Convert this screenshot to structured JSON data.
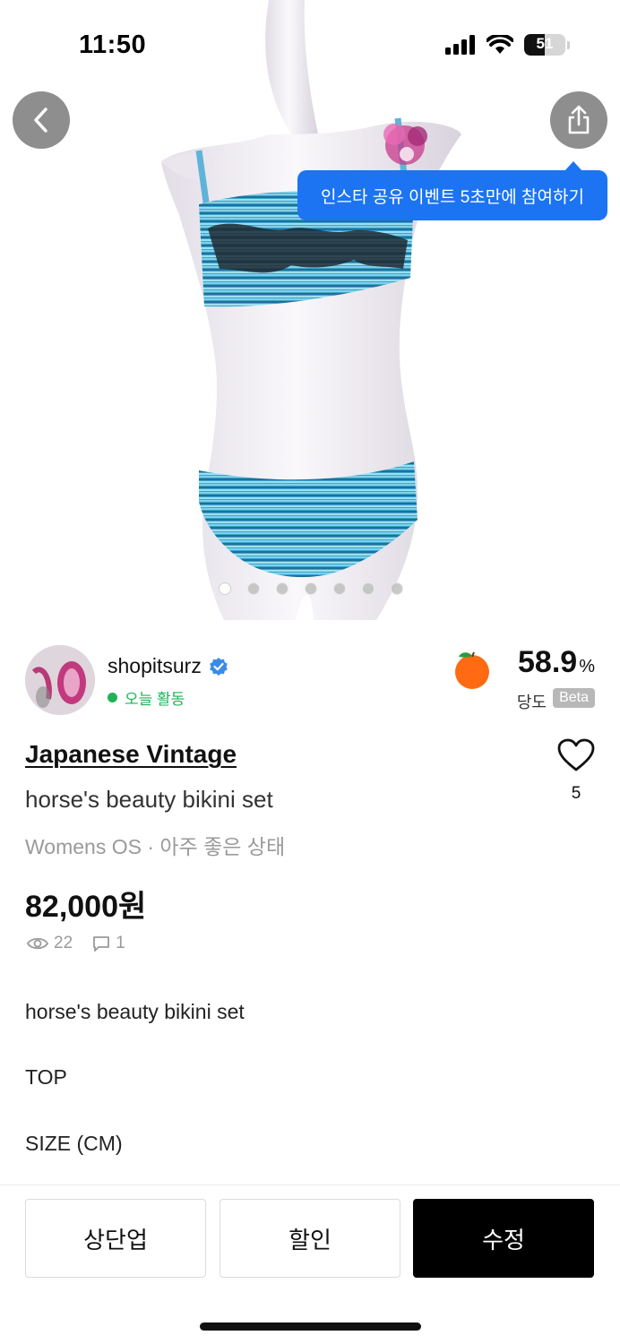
{
  "status_bar": {
    "time": "11:50",
    "battery_level": "51",
    "battery_fraction": 0.51
  },
  "hero": {
    "tooltip_text": "인스타 공유 이벤트 5초만에 참여하기",
    "image_count": 7,
    "active_image_index": 0
  },
  "seller": {
    "name": "shopitsurz",
    "activity": "오늘 활동",
    "sugar_value": "58.9",
    "sugar_unit": "%",
    "sugar_label": "당도",
    "beta_label": "Beta"
  },
  "product": {
    "brand": "Japanese Vintage",
    "title": "horse's beauty bikini set",
    "meta": "Womens OS · 아주 좋은 상태",
    "price": "82,000원",
    "views": "22",
    "chats": "1",
    "likes": "5"
  },
  "description": {
    "line1": "horse's beauty bikini set",
    "line2": "TOP",
    "line3": "SIZE (CM)"
  },
  "actions": {
    "up_label": "상단업",
    "discount_label": "할인",
    "edit_label": "수정"
  },
  "colors": {
    "accent_blue": "#1c74f2",
    "active_green": "#1fb256",
    "orange": "#ff6a13"
  },
  "icons": [
    "back-icon",
    "share-icon",
    "verified-icon",
    "orange-icon",
    "heart-icon",
    "eye-icon",
    "chat-icon"
  ]
}
